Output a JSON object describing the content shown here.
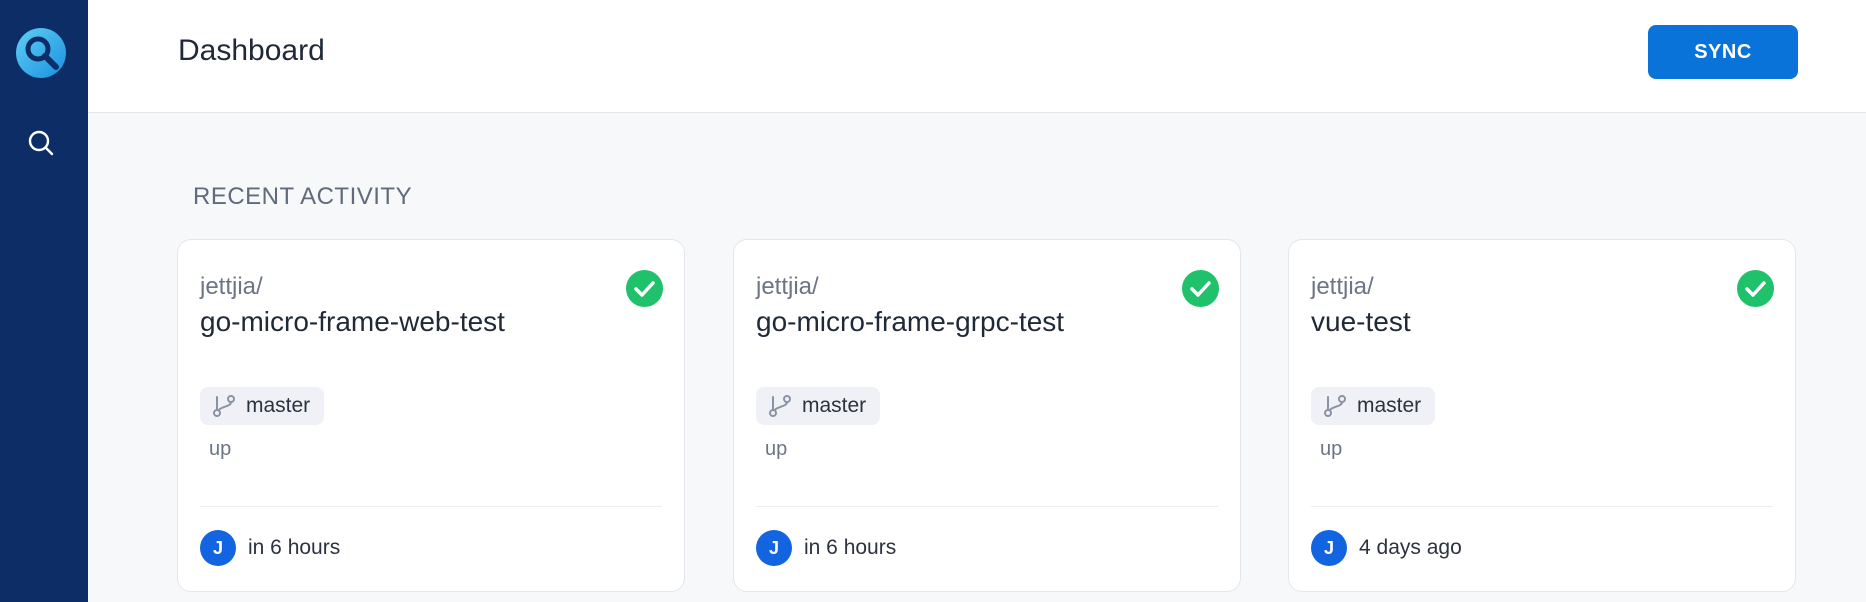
{
  "header": {
    "title": "Dashboard",
    "sync_label": "SYNC"
  },
  "sidebar": {
    "logo_icon": "logo-icon",
    "search_icon": "search-icon"
  },
  "colors": {
    "sidebar": "#0d2d66",
    "accent": "#0a73d9",
    "success": "#1fc16b",
    "avatar": "#1264e0"
  },
  "recent": {
    "title": "RECENT ACTIVITY",
    "cards": [
      {
        "owner": "jettjia/",
        "repo": "go-micro-frame-web-test",
        "status": "success",
        "branch": "master",
        "message": "up",
        "avatar": "J",
        "time": "in 6 hours"
      },
      {
        "owner": "jettjia/",
        "repo": "go-micro-frame-grpc-test",
        "status": "success",
        "branch": "master",
        "message": "up",
        "avatar": "J",
        "time": "in 6 hours"
      },
      {
        "owner": "jettjia/",
        "repo": "vue-test",
        "status": "success",
        "branch": "master",
        "message": "up",
        "avatar": "J",
        "time": "4 days ago"
      }
    ]
  }
}
